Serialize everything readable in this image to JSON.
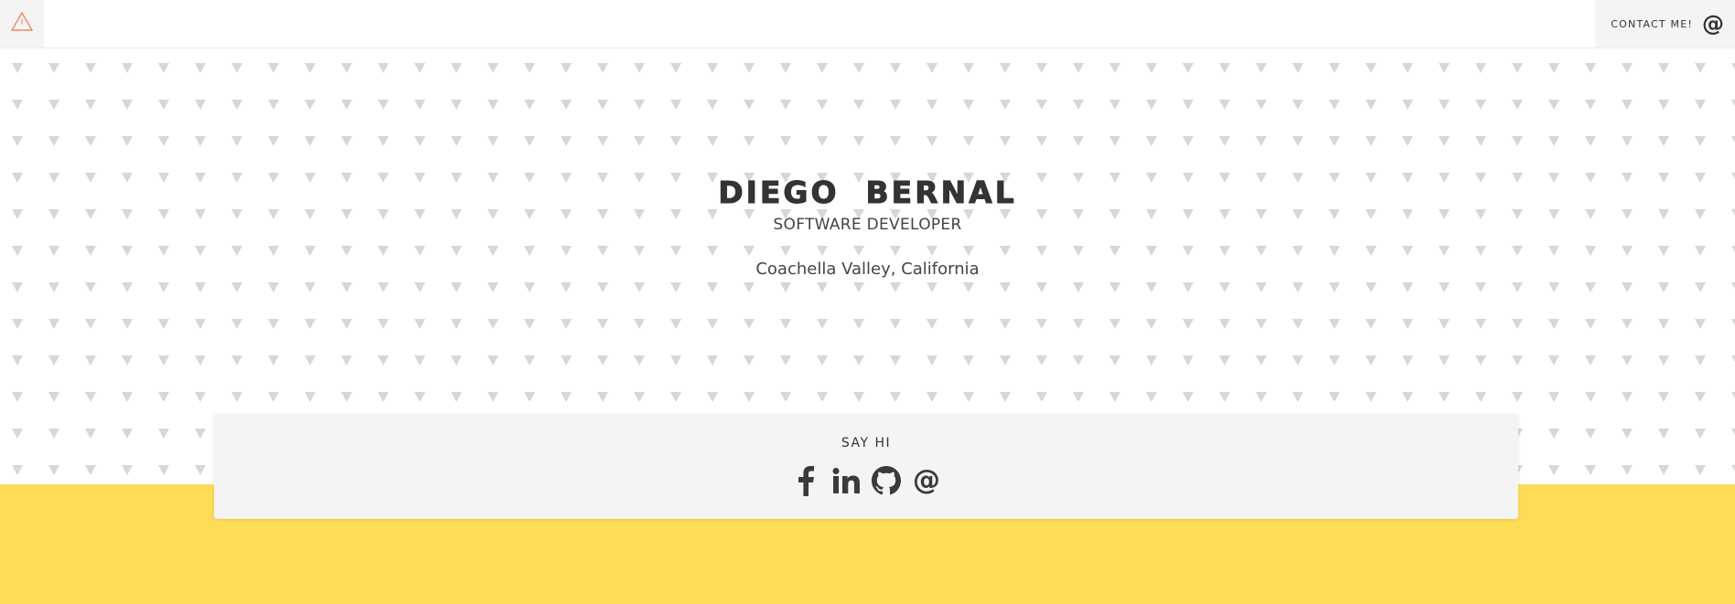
{
  "nav": {
    "logo_icon": "triangle-logo-icon",
    "contact_label": "CONTACT ME!",
    "contact_icon": "@"
  },
  "hero": {
    "name": "DIEGO  BERNAL",
    "role": "SOFTWARE DEVELOPER",
    "location": "Coachella Valley, California"
  },
  "say_hi": {
    "title": "SAY HI",
    "icons": [
      "facebook-icon",
      "linkedin-icon",
      "github-icon",
      "email-at-icon"
    ],
    "email_symbol": "@"
  },
  "colors": {
    "accent_logo": "#f08a5d",
    "text": "#333333",
    "pattern": "#d7d7d7",
    "card": "#f4f4f4",
    "footer": "#ffdc56"
  }
}
